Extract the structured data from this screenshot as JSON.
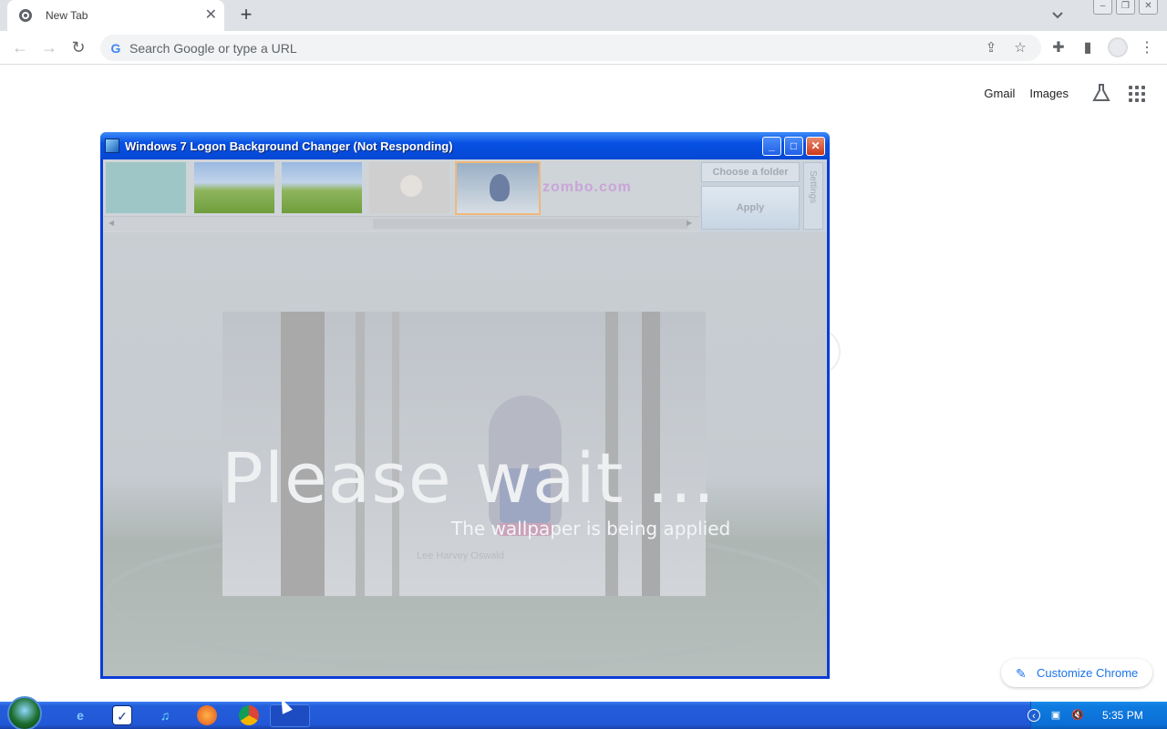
{
  "browser": {
    "tab": {
      "title": "New Tab"
    },
    "omnibox": {
      "placeholder": "Search Google or type a URL"
    }
  },
  "ntp": {
    "links": [
      "Gmail",
      "Images"
    ],
    "customize_label": "Customize Chrome"
  },
  "app_window": {
    "title": "Windows 7 Logon Background Changer (Not Responding)",
    "thumbnail_text": "zombo.com",
    "buttons": {
      "choose_folder": "Choose a folder",
      "apply": "Apply",
      "settings": "Settings"
    },
    "overlay": {
      "headline": "Please wait ...",
      "subtitle": "The wallpaper is being applied",
      "credit": "Lee Harvey Oswald"
    }
  },
  "taskbar": {
    "clock": "5:35 PM",
    "pinned": [
      "internet-explorer-icon",
      "tasks-icon",
      "music-icon",
      "firefox-icon",
      "chrome-icon",
      "app-icon"
    ]
  },
  "colors": {
    "xp_titlebar": "#0751e3",
    "taskbar": "#245edb",
    "chrome_accent": "#1a73e8"
  }
}
